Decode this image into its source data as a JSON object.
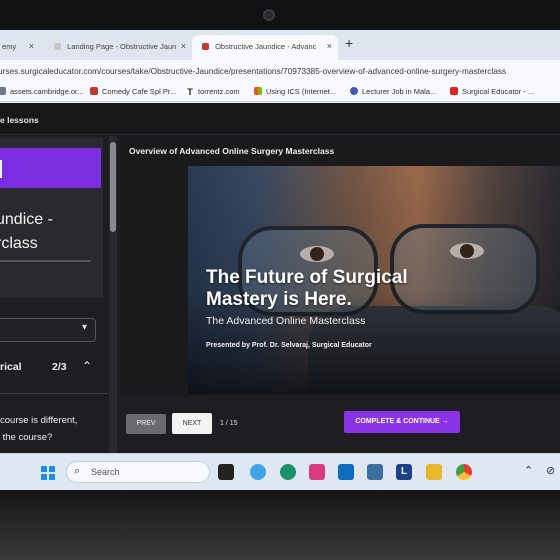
{
  "browser": {
    "tabs": [
      {
        "label": "emy",
        "active": false
      },
      {
        "label": "Landing Page - Obstructive Jaun",
        "active": false
      },
      {
        "label": "Obstructive Jaundice - Advanc",
        "active": true
      }
    ],
    "new_tab": "+",
    "close": "×",
    "url": "urses.surgicaleducator.com/courses/take/Obstructive-Jaundice/presentations/70973385-overview-of-advanced-online-surgery-masterclass",
    "bookmarks": [
      "assets.cambridge.or...",
      "Comedy Cafe Spl Pr...",
      "torrentz.com",
      "Using ICS (Internet...",
      "Lecturer Job in Mala...",
      "Surgical Educator - ..."
    ]
  },
  "course": {
    "header": "e lessons",
    "sidebar": {
      "title": "undice -\nrclass",
      "module_name": "rical",
      "module_count": "2/3",
      "question": "course is different,\n the course?"
    },
    "lesson_title": "Overview of Advanced Online Surgery Masterclass",
    "slide": {
      "headline": "The Future of Surgical\nMastery is Here.",
      "subtitle": "The Advanced Online Masterclass",
      "presenter": "Presented by Prof. Dr. Selvaraj, Surgical Educator"
    },
    "controls": {
      "prev": "PREV",
      "next": "NEXT",
      "pager": "1 / 15",
      "complete": "COMPLETE & CONTINUE →"
    }
  },
  "taskbar": {
    "search_placeholder": "Search"
  },
  "colors": {
    "accent": "#8a34e6",
    "sidebar_purple": "#7a2ee0"
  }
}
